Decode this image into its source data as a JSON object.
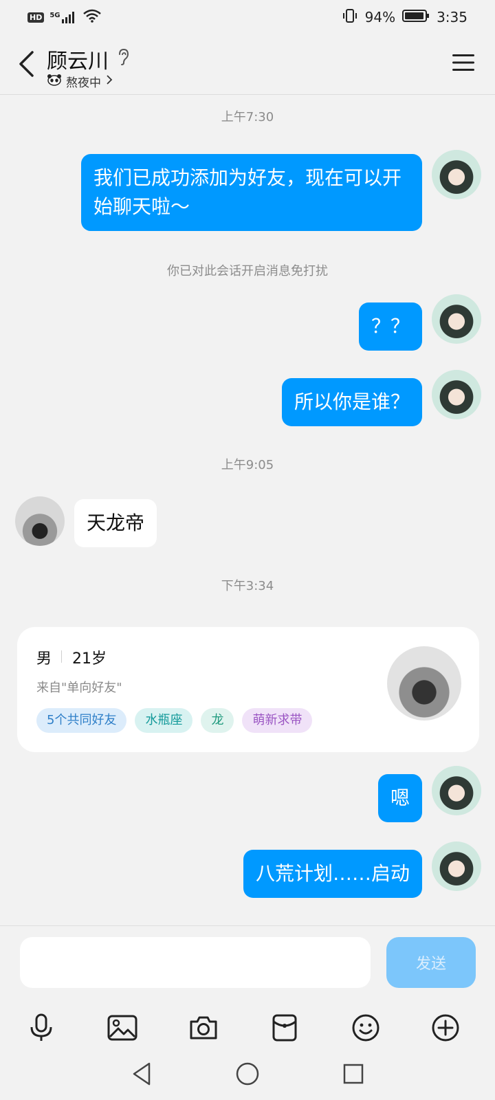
{
  "status_bar": {
    "hd": "HD",
    "network": "5G",
    "battery": "94%",
    "time": "3:35"
  },
  "header": {
    "contact_name": "顾云川",
    "status_text": "熬夜中",
    "icons": [
      "back-arrow-icon",
      "ear-icon",
      "panda-icon",
      "chevron-right-icon",
      "menu-icon"
    ]
  },
  "chat": {
    "timestamps": [
      "上午7:30",
      "上午9:05",
      "下午3:34"
    ],
    "notice": "你已对此会话开启消息免打扰",
    "messages": [
      {
        "sender": "me",
        "text": "我们已成功添加为好友，现在可以开始聊天啦～"
      },
      {
        "sender": "me",
        "text": "？？"
      },
      {
        "sender": "me",
        "text": "所以你是谁？"
      },
      {
        "sender": "them",
        "text": "天龙帝"
      },
      {
        "sender": "me",
        "text": "嗯"
      },
      {
        "sender": "me",
        "text": "八荒计划……启动"
      }
    ]
  },
  "profile_card": {
    "gender": "男",
    "age": "21岁",
    "source": "来自\"单向好友\"",
    "tags": [
      "5个共同好友",
      "水瓶座",
      "龙",
      "萌新求带"
    ]
  },
  "input": {
    "placeholder": "",
    "send_label": "发送"
  },
  "toolbar_icons": [
    "microphone-icon",
    "image-icon",
    "camera-icon",
    "red-packet-icon",
    "emoji-icon",
    "plus-icon"
  ],
  "nav_icons": [
    "back-triangle-icon",
    "home-circle-icon",
    "recents-square-icon"
  ],
  "colors": {
    "bubble_me": "#0099ff",
    "bubble_them": "#ffffff",
    "background": "#f2f2f2",
    "send_disabled": "#7cc6fb"
  }
}
